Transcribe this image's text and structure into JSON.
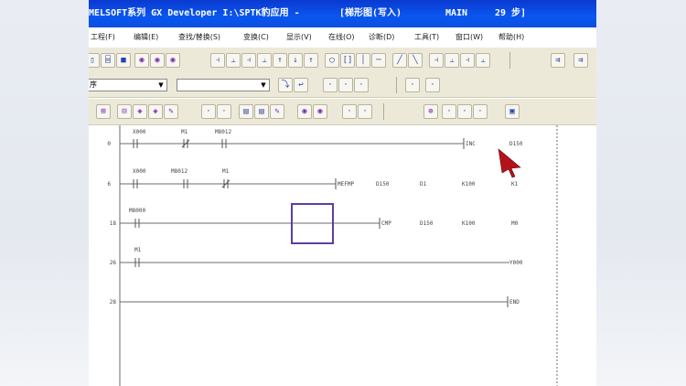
{
  "window": {
    "title_app": "MELSOFT系列 GX Developer I:\\SPTK豹应用 -",
    "title_doc": "[梯形图(写入)",
    "title_main": "MAIN",
    "title_steps": "29 步]"
  },
  "menu": [
    "工程(F)",
    "编辑(E)",
    "查找/替换(S)",
    "变换(C)",
    "显示(V)",
    "在线(O)",
    "诊断(D)",
    "工具(T)",
    "窗口(W)",
    "帮助(H)"
  ],
  "combos": {
    "left_value": "序",
    "middle_value": ""
  },
  "ladder": {
    "rungs": [
      {
        "step": "0",
        "contacts": [
          "X000",
          "M1",
          "M8012"
        ],
        "coil": "INC",
        "operands": [
          "D150"
        ]
      },
      {
        "step": "6",
        "contacts": [
          "X000",
          "M8012",
          "M1"
        ],
        "coil": "MEFMP",
        "operands": [
          "D150",
          "D1",
          "K100",
          "K1"
        ]
      },
      {
        "step": "18",
        "contacts": [
          "M8000"
        ],
        "coil": "CMP",
        "operands": [
          "D150",
          "K100",
          "M0"
        ]
      },
      {
        "step": "26",
        "contacts": [
          "M1"
        ],
        "coil": "Y000",
        "operands": []
      },
      {
        "step": "28",
        "contacts": [],
        "coil": "END",
        "operands": []
      }
    ]
  },
  "colors": {
    "title_bar": "#0a4ce6",
    "cursor_box": "#5a3fa6",
    "toolbar": "#ece9d8",
    "pointer": "#b3121b"
  }
}
